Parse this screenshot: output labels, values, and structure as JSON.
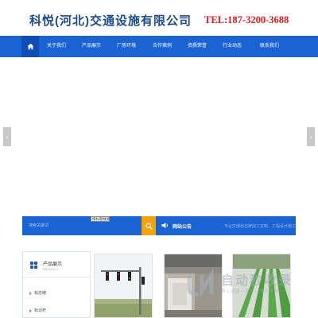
{
  "header": {
    "company_name": "科悦(河北)交通设施有限公司",
    "tel": "TEL:187-3200-3688"
  },
  "nav": {
    "home_icon": "home-icon",
    "items": [
      {
        "label": "关于我们"
      },
      {
        "label": "产品展示"
      },
      {
        "label": "厂房环境"
      },
      {
        "label": "合作案例"
      },
      {
        "label": "资质荣誉"
      },
      {
        "label": "行业动态"
      },
      {
        "label": "联系我们"
      }
    ]
  },
  "banner": {
    "prev_arrow": "‹",
    "next_arrow": "›"
  },
  "search": {
    "placeholder": "搜索关键词",
    "select_value": "按标题搜索",
    "notice_title": "网站公告",
    "notice_text": "专业交通标志牌加工定制、工程设计施工。"
  },
  "sidebar": {
    "title": "产品展示",
    "subtitle": "PRODUCT",
    "items": [
      {
        "label": "标志牌"
      },
      {
        "label": "标识杆"
      }
    ]
  },
  "watermark": {
    "title": "自动秒收录",
    "subtitle": "一 做上链接—来访—自动收录 一"
  },
  "colors": {
    "nav_blue": "#1a63d3",
    "accent_orange": "#f4a40a",
    "tel_red": "#e01a1a",
    "title_blue": "#1f4a8c"
  }
}
